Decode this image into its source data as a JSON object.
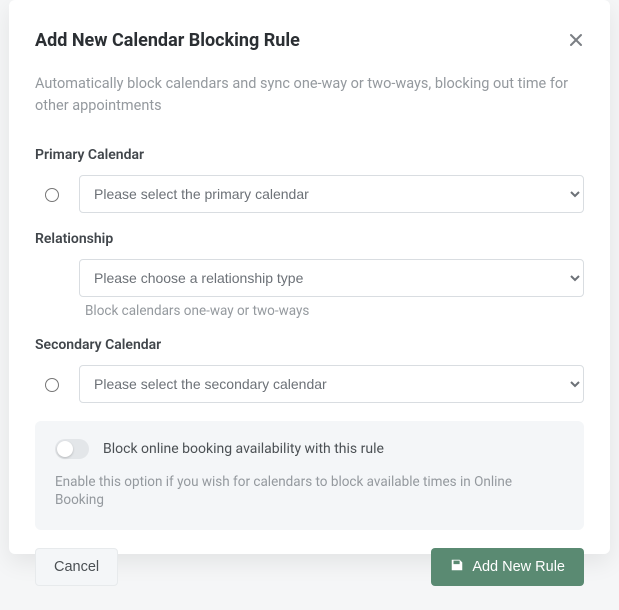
{
  "modal": {
    "title": "Add New Calendar Blocking Rule",
    "description": "Automatically block calendars and sync one-way or two-ways, blocking out time for other appointments"
  },
  "fields": {
    "primary": {
      "label": "Primary Calendar",
      "placeholder": "Please select the primary calendar"
    },
    "relationship": {
      "label": "Relationship",
      "placeholder": "Please choose a relationship type",
      "hint": "Block calendars one-way or two-ways"
    },
    "secondary": {
      "label": "Secondary Calendar",
      "placeholder": "Please select the secondary calendar"
    }
  },
  "option": {
    "toggle_label": "Block online booking availability with this rule",
    "toggle_on": false,
    "help": "Enable this option if you wish for calendars to block available times in Online Booking"
  },
  "buttons": {
    "cancel": "Cancel",
    "submit": "Add New Rule"
  },
  "colors": {
    "primary_button": "#5a8a72",
    "muted_text": "#94999e"
  }
}
